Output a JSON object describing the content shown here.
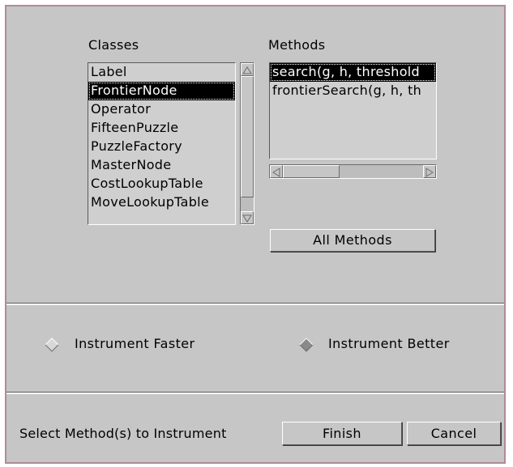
{
  "classes": {
    "label": "Classes",
    "items": [
      {
        "label": "Label",
        "selected": false
      },
      {
        "label": "FrontierNode",
        "selected": true
      },
      {
        "label": "Operator",
        "selected": false
      },
      {
        "label": "FifteenPuzzle",
        "selected": false
      },
      {
        "label": "PuzzleFactory",
        "selected": false
      },
      {
        "label": "MasterNode",
        "selected": false
      },
      {
        "label": "CostLookupTable",
        "selected": false
      },
      {
        "label": "MoveLookupTable",
        "selected": false
      }
    ]
  },
  "methods": {
    "label": "Methods",
    "items": [
      {
        "label": "search(g, h, threshold",
        "selected": true
      },
      {
        "label": "frontierSearch(g, h, th",
        "selected": false
      }
    ],
    "all_methods_label": "All Methods"
  },
  "options": {
    "instrument_faster": "Instrument Faster",
    "instrument_better": "Instrument Better"
  },
  "footer": {
    "status": "Select Method(s) to Instrument",
    "finish_label": "Finish",
    "cancel_label": "Cancel"
  },
  "colors": {
    "background": "#c6c6c6",
    "selection": "#000000",
    "border_accent": "#b08a9a"
  }
}
